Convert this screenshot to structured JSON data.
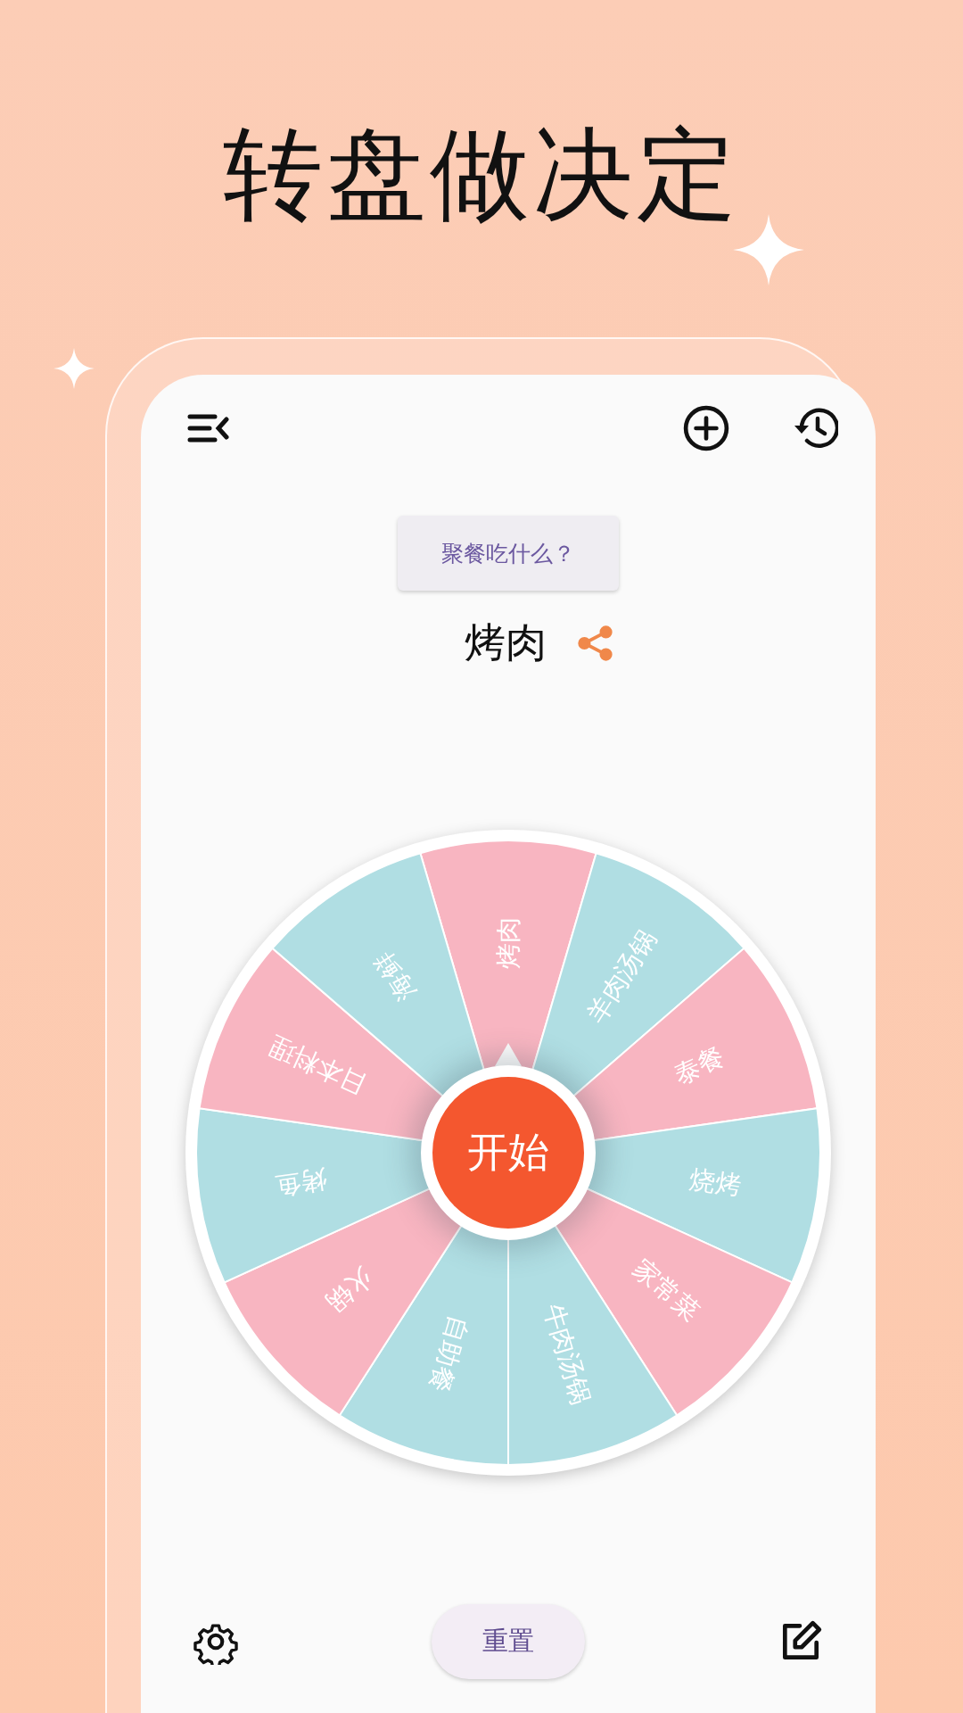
{
  "headline": "转盘做决定",
  "topic_button": "聚餐吃什么？",
  "result": "烤肉",
  "wheel": {
    "start_button": "开始",
    "segments": [
      {
        "label": "烤肉",
        "color": "#f8b5c1"
      },
      {
        "label": "羊肉汤锅",
        "color": "#b0dee3"
      },
      {
        "label": "泰餐",
        "color": "#f8b5c1"
      },
      {
        "label": "烧烤",
        "color": "#b0dee3"
      },
      {
        "label": "家常菜",
        "color": "#f8b5c1"
      },
      {
        "label": "牛肉汤锅",
        "color": "#b0dee3"
      },
      {
        "label": "自助餐",
        "color": "#b0dee3"
      },
      {
        "label": "火锅",
        "color": "#f8b5c1"
      },
      {
        "label": "烤鱼",
        "color": "#b0dee3"
      },
      {
        "label": "日本料理",
        "color": "#f8b5c1"
      },
      {
        "label": "海鲜",
        "color": "#b0dee3"
      }
    ]
  },
  "reset_button": "重置"
}
